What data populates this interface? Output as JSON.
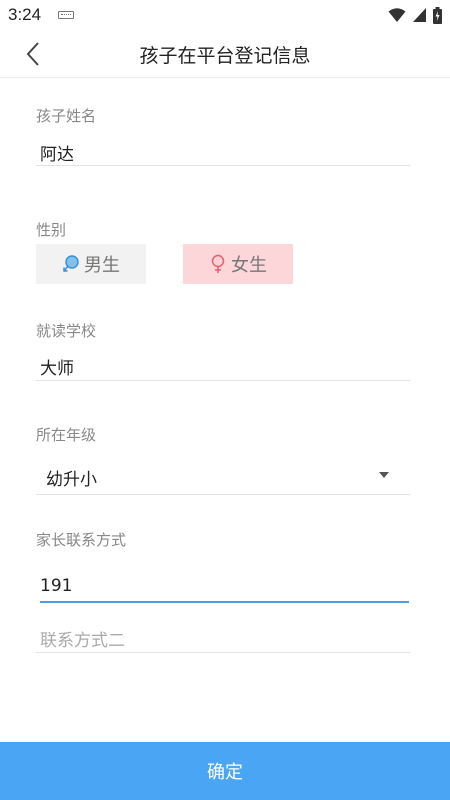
{
  "status_bar": {
    "time": "3:24",
    "icons": [
      "keyboard-icon",
      "wifi-icon",
      "signal-icon",
      "battery-icon"
    ]
  },
  "app_bar": {
    "title": "孩子在平台登记信息",
    "back_icon": "chevron-left-icon"
  },
  "form": {
    "child_name": {
      "label": "孩子姓名",
      "value": "阿达"
    },
    "gender": {
      "label": "性别",
      "options": [
        {
          "label": "男生",
          "icon": "male-icon",
          "selected": false
        },
        {
          "label": "女生",
          "icon": "female-icon",
          "selected": true
        }
      ]
    },
    "school": {
      "label": "就读学校",
      "value": "大师"
    },
    "grade": {
      "label": "所在年级",
      "value": "幼升小"
    },
    "parent_contact": {
      "label": "家长联系方式",
      "value": "191",
      "secondary_placeholder": "联系方式二"
    }
  },
  "confirm_button": {
    "label": "确定"
  },
  "colors": {
    "accent": "#4aa6f5",
    "input_active": "#4a9ee8",
    "female_selected_bg": "#fcd6d8",
    "male_bg": "#f2f2f2"
  }
}
